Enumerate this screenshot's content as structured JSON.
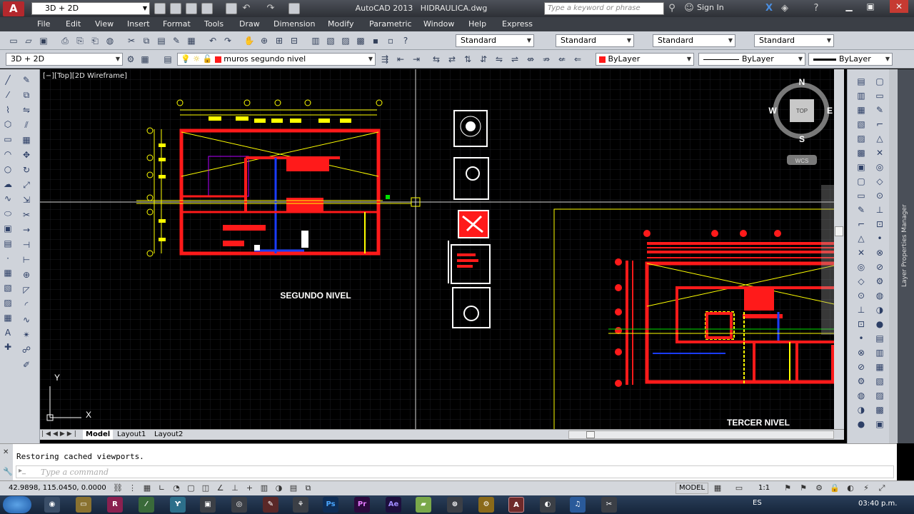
{
  "title_bar": {
    "workspace": "3D + 2D",
    "app_title": "AutoCAD 2013",
    "file_name": "HIDRAULICA.dwg",
    "search_placeholder": "Type a keyword or phrase",
    "sign_in": "Sign In"
  },
  "menu": [
    "File",
    "Edit",
    "View",
    "Insert",
    "Format",
    "Tools",
    "Draw",
    "Dimension",
    "Modify",
    "Parametric",
    "Window",
    "Help",
    "Express"
  ],
  "toolbar1": {
    "text_style": "Standard",
    "dim_style": "Standard",
    "table_style": "Standard",
    "multileader_style": "Standard"
  },
  "toolbar2": {
    "workspace": "3D + 2D",
    "layer": "muros segundo nivel",
    "color": "ByLayer",
    "linetype": "ByLayer",
    "lineweight": "ByLayer"
  },
  "viewport": {
    "label": "[−][Top][2D Wireframe]",
    "label_upper_level": "SEGUNDO NIVEL",
    "label_third_level": "TERCER NIVEL",
    "viewcube": {
      "north": "N",
      "south": "S",
      "east": "E",
      "west": "W",
      "top": "TOP",
      "wcs": "WCS"
    },
    "ucs_x": "X",
    "ucs_y": "Y"
  },
  "layout_tabs": [
    "Model",
    "Layout1",
    "Layout2"
  ],
  "right_panel_label": "Layer Properties Manager",
  "command": {
    "history": "Restoring cached viewports.",
    "placeholder": "Type a command"
  },
  "status": {
    "coordinates": "42.9898, 115.0450, 0.0000",
    "model": "MODEL",
    "scale": "1:1"
  },
  "taskbar": {
    "language": "ES",
    "clock": "03:40 p.m."
  },
  "colors": {
    "walls": "#ff1a1a",
    "dims": "#ffff00",
    "pipes": "#1a3cff",
    "accent": "#00e000"
  }
}
